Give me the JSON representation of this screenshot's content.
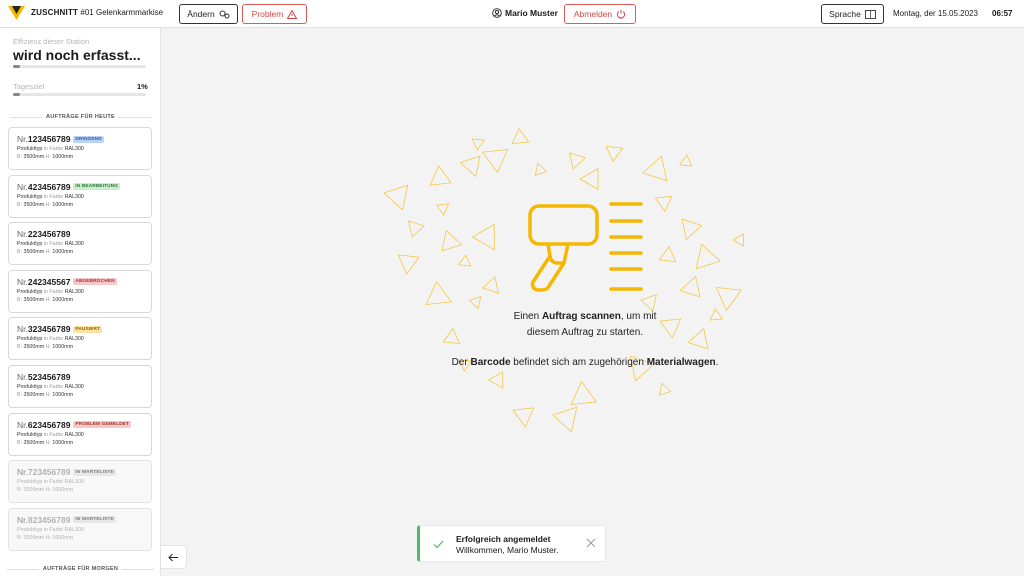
{
  "header": {
    "brand": "ZUSCHNITT",
    "station_number": "#01",
    "station_name": "Gelenkarmmarkise",
    "change_label": "Ändern",
    "problem_label": "Problem",
    "user_name": "Mario Muster",
    "logout_label": "Abmelden",
    "language_label": "Sprache",
    "date": "Montag, der 15.05.2023",
    "time": "06:57"
  },
  "sidebar": {
    "efficiency_label": "Effizienz dieser Station",
    "efficiency_value": "wird noch erfasst...",
    "efficiency_fraction": 0.05,
    "goal_label": "Tagesziel",
    "goal_value": "1%",
    "goal_fraction": 0.05,
    "today_heading": "AUFTRÄGE FÜR HEUTE",
    "tomorrow_heading": "AUFTRÄGE FÜR MORGEN",
    "orders": [
      {
        "prefix": "Nr.",
        "number": "123456789",
        "status": "DRINGEND",
        "status_color": "#b9d2f5",
        "status_text_color": "#2c5aa0",
        "waiting": false,
        "type_label": "Produkttyp",
        "color_label": "in Farbe",
        "color": "RAL300",
        "width_label": "B:",
        "width": "3500mm",
        "height_label": "H:",
        "height": "1000mm"
      },
      {
        "prefix": "Nr.",
        "number": "423456789",
        "status": "IN BEARBEITUNG",
        "status_color": "#cdeccd",
        "status_text_color": "#2d7d3a",
        "waiting": false,
        "type_label": "Produkttyp",
        "color_label": "in Farbe",
        "color": "RAL300",
        "width_label": "B:",
        "width": "3500mm",
        "height_label": "H:",
        "height": "1000mm"
      },
      {
        "prefix": "Nr.",
        "number": "223456789",
        "status": "",
        "status_color": "",
        "status_text_color": "",
        "waiting": false,
        "type_label": "Produkttyp",
        "color_label": "in Farbe",
        "color": "RAL300",
        "width_label": "B:",
        "width": "3500mm",
        "height_label": "H:",
        "height": "1000mm"
      },
      {
        "prefix": "Nr.",
        "number": "242345567",
        "status": "ABGEBROCHEN",
        "status_color": "#f6c9c9",
        "status_text_color": "#b03030",
        "waiting": false,
        "type_label": "Produkttyp",
        "color_label": "in Farbe",
        "color": "RAL300",
        "width_label": "B:",
        "width": "3500mm",
        "height_label": "H:",
        "height": "1000mm"
      },
      {
        "prefix": "Nr.",
        "number": "323456789",
        "status": "PAUSIERT",
        "status_color": "#fbe2a6",
        "status_text_color": "#8a6200",
        "waiting": false,
        "type_label": "Produkttyp",
        "color_label": "in Farbe",
        "color": "RAL300",
        "width_label": "B:",
        "width": "3500mm",
        "height_label": "H:",
        "height": "1000mm"
      },
      {
        "prefix": "Nr.",
        "number": "523456789",
        "status": "",
        "status_color": "",
        "status_text_color": "",
        "waiting": false,
        "type_label": "Produkttyp",
        "color_label": "in Farbe",
        "color": "RAL300",
        "width_label": "B:",
        "width": "3500mm",
        "height_label": "H:",
        "height": "1000mm"
      },
      {
        "prefix": "Nr.",
        "number": "623456789",
        "status": "PROBLEM GEMELDET",
        "status_color": "#f6c9c9",
        "status_text_color": "#b03030",
        "waiting": false,
        "type_label": "Produkttyp",
        "color_label": "in Farbe",
        "color": "RAL300",
        "width_label": "B:",
        "width": "3500mm",
        "height_label": "H:",
        "height": "1000mm"
      },
      {
        "prefix": "Nr.",
        "number": "723456789",
        "status": "IN WARTELISTE",
        "status_color": "#e0e0e0",
        "status_text_color": "#555555",
        "waiting": true,
        "type_label": "Produkttyp",
        "color_label": "in Farbe",
        "color": "RAL300",
        "width_label": "B:",
        "width": "3500mm",
        "height_label": "H:",
        "height": "1000mm"
      },
      {
        "prefix": "Nr.",
        "number": "823456789",
        "status": "IN WARTELISTE",
        "status_color": "#e0e0e0",
        "status_text_color": "#555555",
        "waiting": true,
        "type_label": "Produkttyp",
        "color_label": "in Farbe",
        "color": "RAL300",
        "width_label": "B:",
        "width": "3500mm",
        "height_label": "H:",
        "height": "1000mm"
      }
    ]
  },
  "main": {
    "scan_line1_pre": "Einen",
    "scan_line1_bold": "Auftrag scannen",
    "scan_line1_post": ", um mit",
    "scan_line2": "diesem Auftrag zu starten.",
    "barcode_pre": "Der",
    "barcode_bold": "Barcode",
    "barcode_mid": "befindet sich am zugehörigen",
    "barcode_bold2": "Materialwagen",
    "barcode_post": ".",
    "scanner_icon": "barcode-scanner-icon",
    "accent_color": "#f5b800"
  },
  "toast": {
    "title": "Erfolgreich angemeldet",
    "message": "Willkommen, Mario Muster.",
    "icon": "check-icon",
    "accent_color": "#4cbc6c"
  }
}
